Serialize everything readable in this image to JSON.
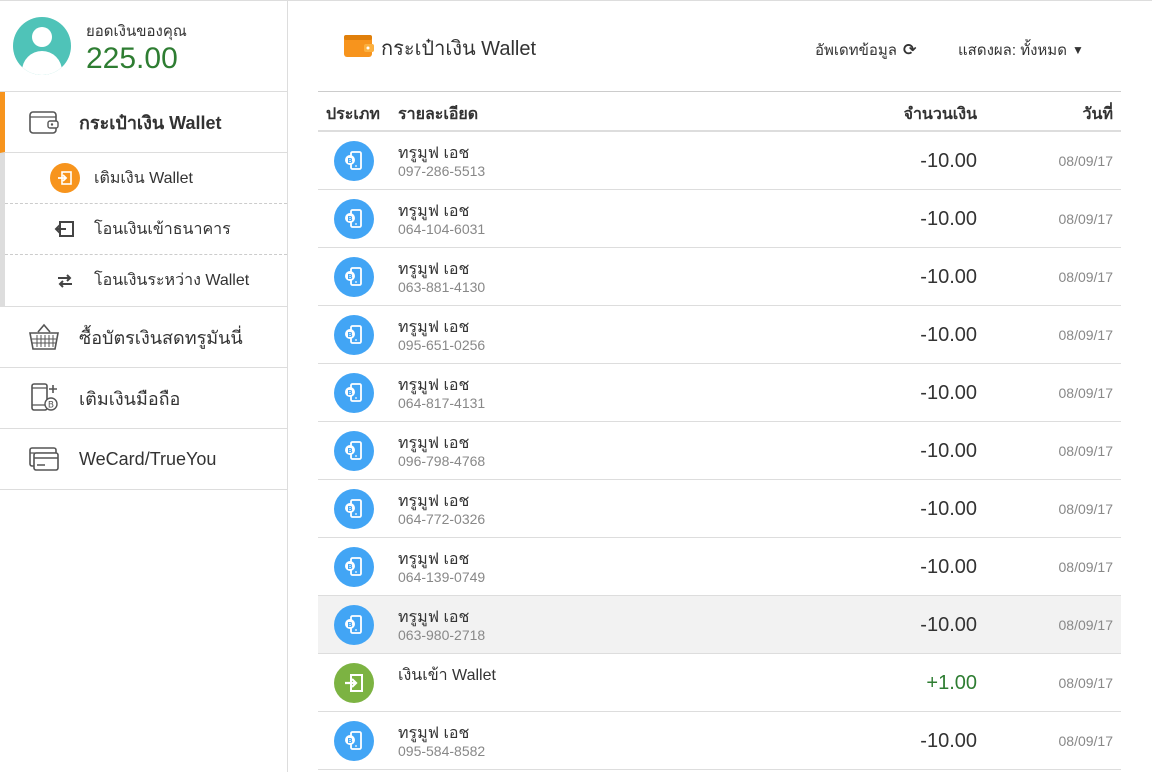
{
  "balance": {
    "label": "ยอดเงินของคุณ",
    "value": "225.00"
  },
  "nav": {
    "wallet": {
      "label": "กระเป๋าเงิน Wallet"
    },
    "sub": [
      {
        "label": "เติมเงิน Wallet",
        "icon": "topup-icon"
      },
      {
        "label": "โอนเงินเข้าธนาคาร",
        "icon": "bank-transfer-icon"
      },
      {
        "label": "โอนเงินระหว่าง Wallet",
        "icon": "transfer-arrows-icon"
      }
    ],
    "cash_card": {
      "label": "ซื้อบัตรเงินสดทรูมันนี่"
    },
    "mobile_topup": {
      "label": "เติมเงินมือถือ"
    },
    "wecard": {
      "label": "WeCard/TrueYou"
    }
  },
  "header": {
    "title": "กระเป๋าเงิน Wallet",
    "refresh_label": "อัพเดทข้อมูล",
    "filter_label": "แสดงผล: ทั้งหมด"
  },
  "table": {
    "headers": {
      "type": "ประเภท",
      "detail": "รายละเอียด",
      "amount": "จำนวนเงิน",
      "date": "วันที่"
    },
    "rows": [
      {
        "kind": "mobile",
        "name": "ทรูมูฟ เอช",
        "phone": "097-286-5513",
        "amount": "-10.00",
        "date": "08/09/17"
      },
      {
        "kind": "mobile",
        "name": "ทรูมูฟ เอช",
        "phone": "064-104-6031",
        "amount": "-10.00",
        "date": "08/09/17"
      },
      {
        "kind": "mobile",
        "name": "ทรูมูฟ เอช",
        "phone": "063-881-4130",
        "amount": "-10.00",
        "date": "08/09/17"
      },
      {
        "kind": "mobile",
        "name": "ทรูมูฟ เอช",
        "phone": "095-651-0256",
        "amount": "-10.00",
        "date": "08/09/17"
      },
      {
        "kind": "mobile",
        "name": "ทรูมูฟ เอช",
        "phone": "064-817-4131",
        "amount": "-10.00",
        "date": "08/09/17"
      },
      {
        "kind": "mobile",
        "name": "ทรูมูฟ เอช",
        "phone": "096-798-4768",
        "amount": "-10.00",
        "date": "08/09/17"
      },
      {
        "kind": "mobile",
        "name": "ทรูมูฟ เอช",
        "phone": "064-772-0326",
        "amount": "-10.00",
        "date": "08/09/17"
      },
      {
        "kind": "mobile",
        "name": "ทรูมูฟ เอช",
        "phone": "064-139-0749",
        "amount": "-10.00",
        "date": "08/09/17"
      },
      {
        "kind": "mobile",
        "name": "ทรูมูฟ เอช",
        "phone": "063-980-2718",
        "amount": "-10.00",
        "date": "08/09/17"
      },
      {
        "kind": "wallet-in",
        "name": "เงินเข้า Wallet",
        "phone": "",
        "amount": "+1.00",
        "date": "08/09/17"
      },
      {
        "kind": "mobile",
        "name": "ทรูมูฟ เอช",
        "phone": "095-584-8582",
        "amount": "-10.00",
        "date": "08/09/17"
      }
    ]
  },
  "colors": {
    "accent": "#f7941d",
    "balance": "#2e7d32",
    "mobile_icon": "#42a5f5",
    "wallet_in_icon": "#7cb342"
  }
}
